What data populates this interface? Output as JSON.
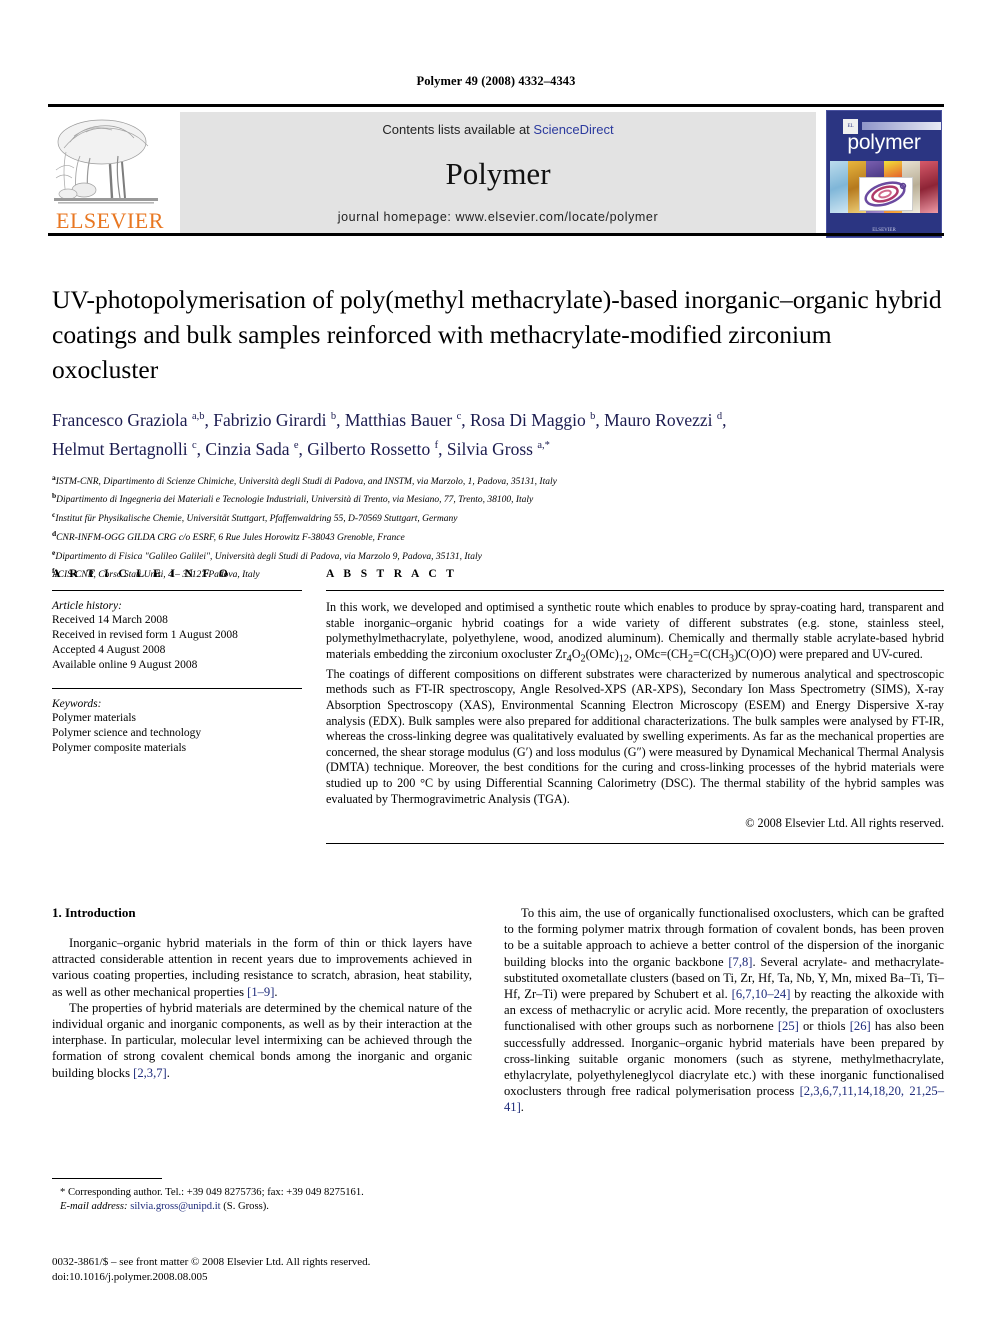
{
  "running_head": "Polymer 49 (2008) 4332–4343",
  "banner": {
    "contents_prefix": "Contents lists available at ",
    "sciencedirect": "ScienceDirect",
    "journal_title": "Polymer",
    "homepage": "journal homepage: www.elsevier.com/locate/polymer",
    "elsevier_wordmark": "ELSEVIER",
    "cover_word": "polymer",
    "cover_publisher": "ELSEVIER",
    "cover_el_mark": "EL"
  },
  "colors": {
    "link_blue": "#2b3a9e",
    "cite_blue": "#1d2a7a",
    "elsevier_orange": "#E87722",
    "cover_blue": "#2b3582",
    "banner_gray": "#e3e3e3"
  },
  "article": {
    "title": "UV-photopolymerisation of poly(methyl methacrylate)-based inorganic–organic hybrid coatings and bulk samples reinforced with methacrylate-modified zirconium oxocluster",
    "authors_line_1": "Francesco Graziola a,b, Fabrizio Girardi b, Matthias Bauer c, Rosa Di Maggio b, Mauro Rovezzi d,",
    "authors_line_2": "Helmut Bertagnolli c, Cinzia Sada e, Gilberto Rossetto f, Silvia Gross a,*",
    "affiliations": [
      {
        "mark": "a",
        "text": "ISTM-CNR, Dipartimento di Scienze Chimiche, Università degli Studi di Padova, and INSTM, via Marzolo, 1, Padova, 35131, Italy"
      },
      {
        "mark": "b",
        "text": "Dipartimento di Ingegneria dei Materiali e Tecnologie Industriali, Università di Trento, via Mesiano, 77, Trento, 38100, Italy"
      },
      {
        "mark": "c",
        "text": "Institut für Physikalische Chemie, Universität Stuttgart, Pfaffenwaldring 55, D-70569 Stuttgart, Germany"
      },
      {
        "mark": "d",
        "text": "CNR-INFM-OGG GILDA CRG c/o ESRF, 6 Rue Jules Horowitz F-38043 Grenoble, France"
      },
      {
        "mark": "e",
        "text": "Dipartimento di Fisica \"Galileo Galilei\", Università degli Studi di Padova, via Marzolo 9, Padova, 35131, Italy"
      },
      {
        "mark": "f",
        "text": "ICIS-CNR, Corso Stati Uniti, 4 – 35127 Padova, Italy"
      }
    ]
  },
  "article_info": {
    "heading": "A R T I C L E    I N F O",
    "history_label": "Article history:",
    "history": [
      "Received 14 March 2008",
      "Received in revised form 1 August 2008",
      "Accepted 4 August 2008",
      "Available online 9 August 2008"
    ],
    "keywords_label": "Keywords:",
    "keywords": [
      "Polymer materials",
      "Polymer science and technology",
      "Polymer composite materials"
    ]
  },
  "abstract": {
    "heading": "A B S T R A C T",
    "paragraph_1_a": "In this work, we developed and optimised a synthetic route which enables to produce by spray-coating hard, transparent and stable inorganic–organic hybrid coatings for a wide variety of different substrates (e.g. stone, stainless steel, polymethylmethacrylate, polyethylene, wood, anodized aluminum). Chemically and thermally stable acrylate-based hybrid materials embedding the zirconium oxocluster Zr",
    "formula_sub_1": "4",
    "formula_mid_1": "O",
    "formula_sub_2": "2",
    "formula_mid_2": "(OMc)",
    "formula_sub_3": "12",
    "paragraph_1_b": ", OMc=(CH",
    "formula_sub_4": "2",
    "paragraph_1_c": "=C(CH",
    "formula_sub_5": "3",
    "paragraph_1_d": ")C(O)O) were prepared and UV-cured.",
    "paragraph_2": "The coatings of different compositions on different substrates were characterized by numerous analytical and spectroscopic methods such as FT-IR spectroscopy, Angle Resolved-XPS (AR-XPS), Secondary Ion Mass Spectrometry (SIMS), X-ray Absorption Spectroscopy (XAS), Environmental Scanning Electron Microscopy (ESEM) and Energy Dispersive X-ray analysis (EDX). Bulk samples were also prepared for additional characterizations. The bulk samples were analysed by FT-IR, whereas the cross-linking degree was qualitatively evaluated by swelling experiments. As far as the mechanical properties are concerned, the shear storage modulus (G′) and loss modulus (G″) were measured by Dynamical Mechanical Thermal Analysis (DMTA) technique. Moreover, the best conditions for the curing and cross-linking processes of the hybrid materials were studied up to 200 °C by using Differential Scanning Calorimetry (DSC). The thermal stability of the hybrid samples was evaluated by Thermogravimetric Analysis (TGA).",
    "copyright": "© 2008 Elsevier Ltd. All rights reserved."
  },
  "introduction": {
    "heading": "1.  Introduction",
    "left_paragraph_1_a": "Inorganic–organic hybrid materials in the form of thin or thick layers have attracted considerable attention in recent years due to improvements achieved in various coating properties, including resistance to scratch, abrasion, heat stability, as well as other mechanical properties ",
    "left_cite_1": "[1–9]",
    "left_paragraph_1_b": ".",
    "left_paragraph_2_a": "The properties of hybrid materials are determined by the chemical nature of the individual organic and inorganic components, as well as by their interaction at the interphase. In particular, molecular level intermixing can be achieved through the formation of strong covalent chemical bonds among the inorganic and organic building blocks ",
    "left_cite_2": "[2,3,7]",
    "left_paragraph_2_b": ".",
    "right_paragraph_a": "To this aim, the use of organically functionalised oxoclusters, which can be grafted to the forming polymer matrix through formation of covalent bonds, has been proven to be a suitable approach to achieve a better control of the dispersion of the inorganic building blocks into the organic backbone ",
    "right_cite_1": "[7,8]",
    "right_paragraph_b": ". Several acrylate- and methacrylate-substituted oxometallate clusters (based on Ti, Zr, Hf, Ta, Nb, Y, Mn, mixed Ba–Ti, Ti–Hf, Zr–Ti) were prepared by Schubert et al. ",
    "right_cite_2": "[6,7,10–24]",
    "right_paragraph_c": " by reacting the alkoxide with an excess of methacrylic or acrylic acid. More recently, the preparation of oxoclusters functionalised with other groups such as norbornene ",
    "right_cite_3": "[25]",
    "right_paragraph_d": " or thiols ",
    "right_cite_4": "[26]",
    "right_paragraph_e": " has also been successfully addressed. Inorganic–organic hybrid materials have been prepared by cross-linking suitable organic monomers (such as styrene, methylmethacrylate, ethylacrylate, polyethyleneglycol diacrylate etc.) with these inorganic functionalised oxoclusters through free radical polymerisation process ",
    "right_cite_5": "[2,3,6,7,11,14,18,20, 21,25–41]",
    "right_paragraph_f": "."
  },
  "footer": {
    "corresponding_marker": "*",
    "corresponding_text": " Corresponding author. Tel.: +39 049 8275736; fax: +39 049 8275161.",
    "email_label": "E-mail address:",
    "email": "silvia.gross@unipd.it",
    "email_suffix": " (S. Gross).",
    "issn_line": "0032-3861/$ – see front matter © 2008 Elsevier Ltd. All rights reserved.",
    "doi_line": "doi:10.1016/j.polymer.2008.08.005"
  }
}
